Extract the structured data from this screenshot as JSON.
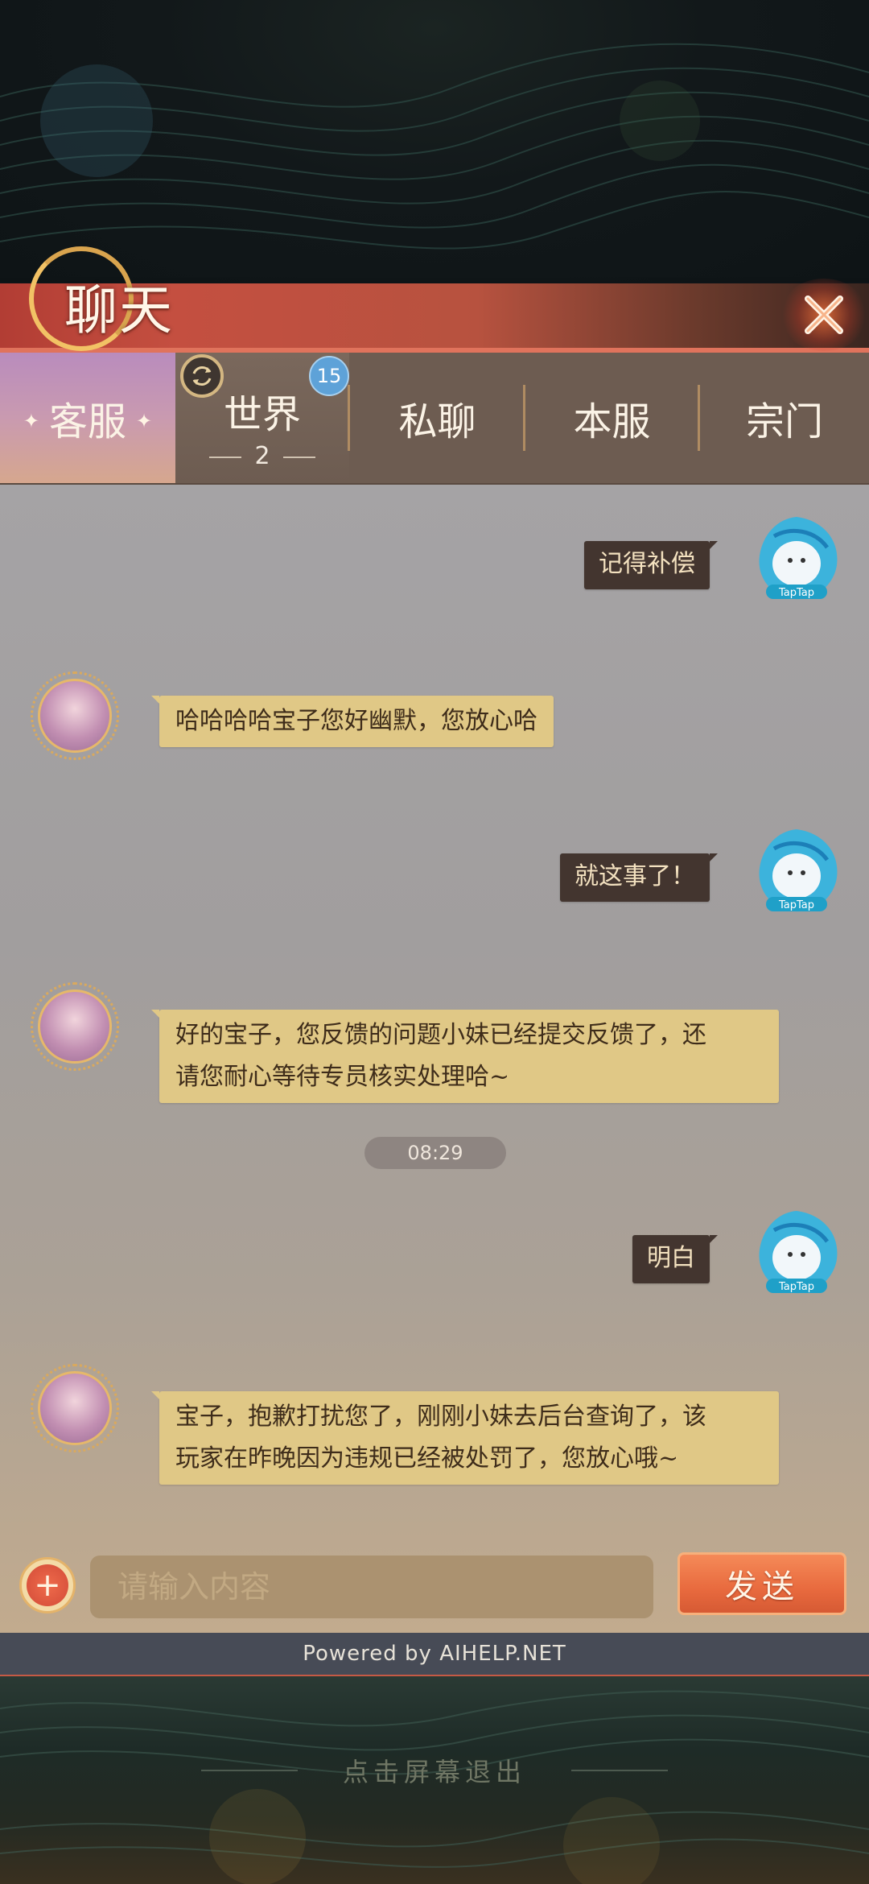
{
  "header": {
    "title": "聊天"
  },
  "tabs": [
    {
      "label": "客服",
      "active": true
    },
    {
      "label": "世界",
      "count": "2",
      "badge": "15"
    },
    {
      "label": "私聊"
    },
    {
      "label": "本服"
    },
    {
      "label": "宗门"
    }
  ],
  "messages": [
    {
      "from": "user",
      "text": "记得补偿"
    },
    {
      "from": "support",
      "lines": [
        "哈哈哈哈宝子您好幽默，您放心哈"
      ]
    },
    {
      "from": "user",
      "text": "就这事了！"
    },
    {
      "from": "support",
      "lines": [
        "好的宝子，您反馈的问题小妹已经提交反馈了，还",
        "请您耐心等待专员核实处理哈~"
      ]
    },
    {
      "from": "user",
      "text": "明白"
    },
    {
      "from": "support",
      "lines": [
        "宝子，抱歉打扰您了，刚刚小妹去后台查询了，该",
        "玩家在昨晚因为违规已经被处罚了，您放心哦~"
      ]
    }
  ],
  "timestamp": "08:29",
  "composer": {
    "placeholder": "请输入内容",
    "value": "",
    "send_label": "发送"
  },
  "footer": {
    "powered_by": "Powered by AIHELP.NET",
    "exit_hint": "点击屏幕退出"
  },
  "colors": {
    "header_red": "#b7523f",
    "user_bubble": "#43352f",
    "support_bubble": "#e0c886",
    "send_button": "#e86a3e",
    "badge_blue": "#5ea2d8"
  },
  "icons": {
    "close": "close-x-icon",
    "plus": "plus-icon",
    "switch": "refresh-icon",
    "user_avatar": "taptap-avatar-icon",
    "support_avatar": "support-agent-avatar-icon"
  }
}
